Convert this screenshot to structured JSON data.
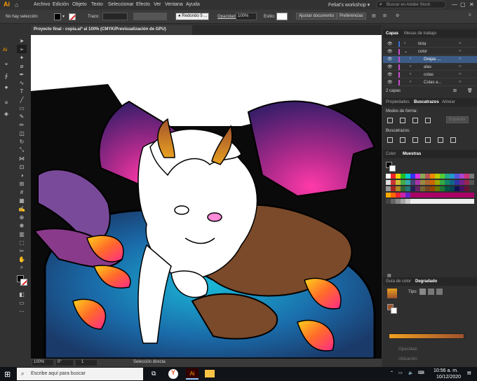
{
  "app": {
    "logo": "Ai"
  },
  "menu": [
    "Archivo",
    "Edición",
    "Objeto",
    "Texto",
    "Seleccionar",
    "Efecto",
    "Ver",
    "Ventana",
    "Ayuda"
  ],
  "workspace": "Feliat's workshop",
  "search_placeholder": "Buscar en Adobe Stock",
  "control_bar": {
    "selection": "No hay selección",
    "stroke_label": "Trazo:",
    "brush": "Redondo 5 ...",
    "opacity_label": "Opacidad:",
    "opacity_value": "100%",
    "style_label": "Estilo:",
    "adjust_doc": "Ajustar documento",
    "preferences": "Preferencias"
  },
  "document_tab": "Proyecto final - copia.ai* al 100% (CMYK/Previsualización de GPU)",
  "status": {
    "zoom": "100%",
    "rotation": "0°",
    "artboard": "1",
    "tool": "Selección directa"
  },
  "panels": {
    "tabs": [
      "Capas",
      "Mesas de trabajo"
    ],
    "layers": [
      {
        "name": "tinta",
        "color": "#3d6fd1"
      },
      {
        "name": "color",
        "color": "#c94bd0"
      },
      {
        "name": "Orejas ...",
        "color": "#c94bd0"
      },
      {
        "name": "alas",
        "color": "#c94bd0"
      },
      {
        "name": "colas",
        "color": "#c94bd0"
      },
      {
        "name": "Colas a...",
        "color": "#c94bd0"
      }
    ],
    "layer_count": "2 capas",
    "prop_tabs": [
      "Propiedades",
      "Buscatrazos",
      "Alinear"
    ],
    "shape_modes": "Modos de forma:",
    "expand": "Expandir",
    "pathfinders": "Buscatrazos:",
    "color_tabs": [
      "Color",
      "Muestras"
    ],
    "gradient_tabs": [
      "Guía de color",
      "Degradado"
    ],
    "gradient_type": "Tipo:",
    "opacity": "Opacidad:",
    "location": "Ubicación:"
  },
  "taskbar": {
    "search": "Escribe aquí para buscar",
    "time": "10:56 a. m.",
    "date": "10/12/2020"
  },
  "colors": {
    "accent": "#2d8ceb",
    "panel_bg": "#2f2f2f"
  }
}
